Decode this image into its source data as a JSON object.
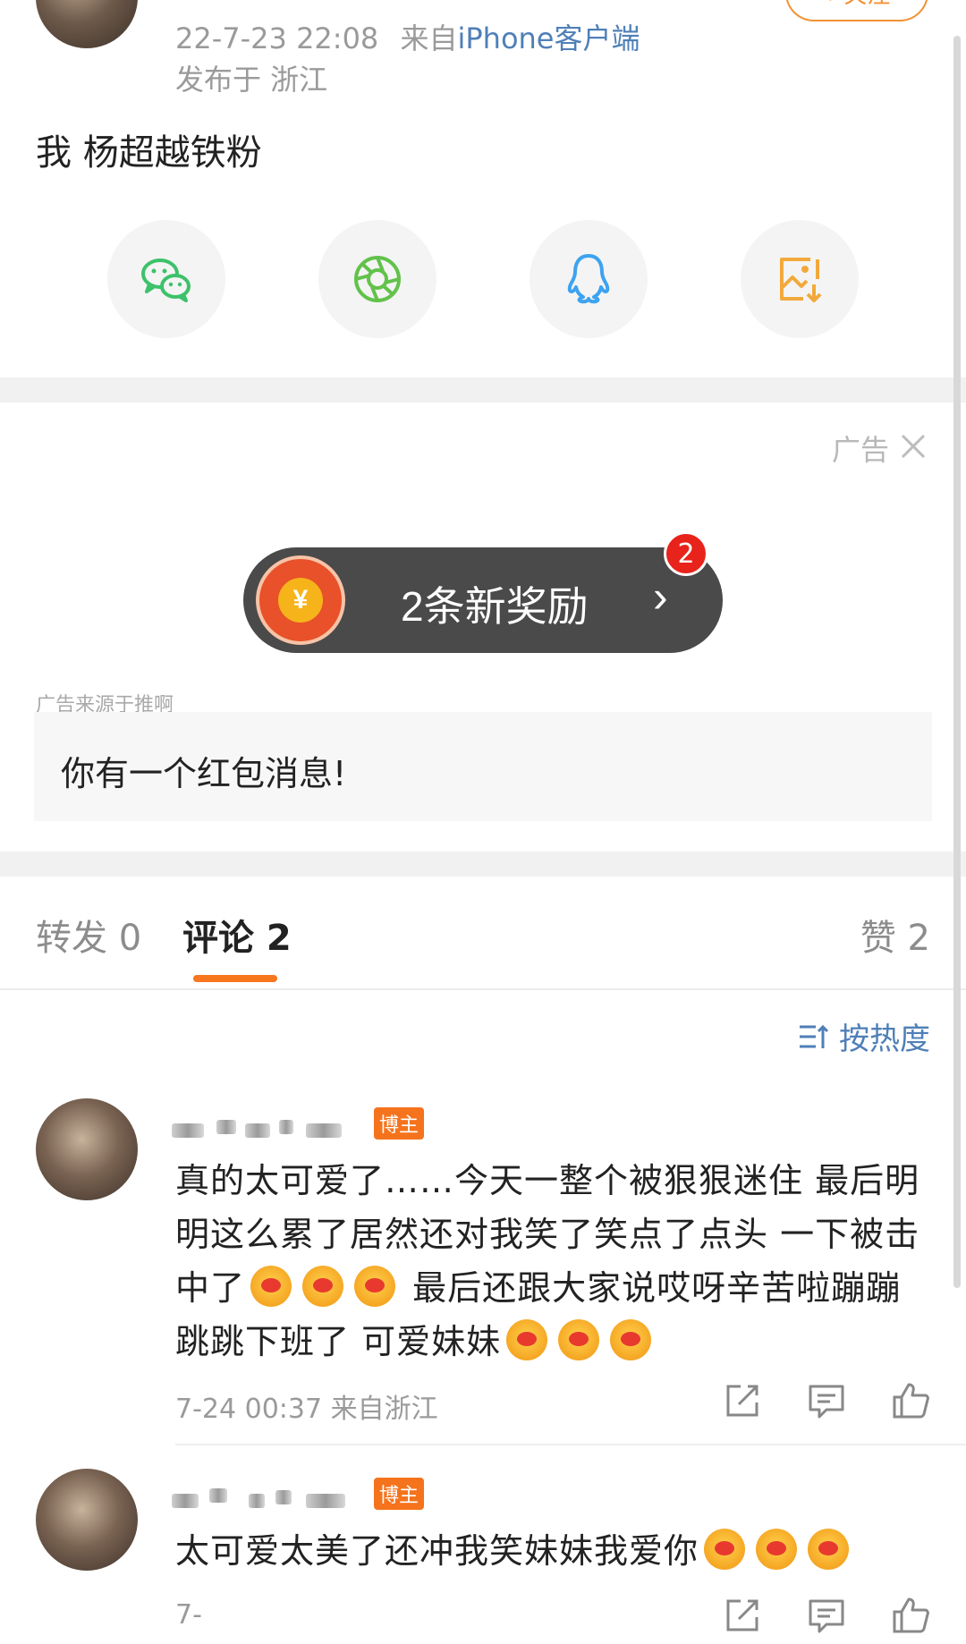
{
  "post": {
    "follow_label": "+ 关注",
    "time": "22-7-23 22:08",
    "from_prefix": "来自",
    "source": "iPhone客户端",
    "location": "发布于 浙江",
    "text": "我 杨超越铁粉"
  },
  "share": {
    "items": [
      {
        "icon": "wechat-icon",
        "color": "#3cc26a"
      },
      {
        "icon": "moments-icon",
        "color": "#62c24b"
      },
      {
        "icon": "qq-icon",
        "color": "#3da3ef"
      },
      {
        "icon": "save-image-icon",
        "color": "#f2a93b"
      }
    ]
  },
  "ad": {
    "label": "广告",
    "reward_text": "2条新奖励",
    "reward_arrow": "›",
    "coin_symbol": "¥",
    "badge_count": "2",
    "source": "广告来源于推啊",
    "message": "你有一个红包消息!"
  },
  "tabs": {
    "repost": "转发 0",
    "comment": "评论 2",
    "like": "赞 2",
    "active_color": "#f7761e"
  },
  "sort": {
    "label": "按热度"
  },
  "comments": [
    {
      "badge": "博主",
      "text_parts": [
        "真的太可爱了……今天一整个被狠狠迷住 最后明明这么累了居然还对我笑了笑点了点头 一下被击中了",
        " 最后还跟大家说哎呀辛苦啦蹦蹦跳跳下班了 可爱妹妹"
      ],
      "time": "7-24 00:37 来自浙江"
    },
    {
      "badge": "博主",
      "text_parts": [
        "太可爱太美了还冲我笑妹妹我爱你"
      ],
      "time": "7-"
    }
  ]
}
